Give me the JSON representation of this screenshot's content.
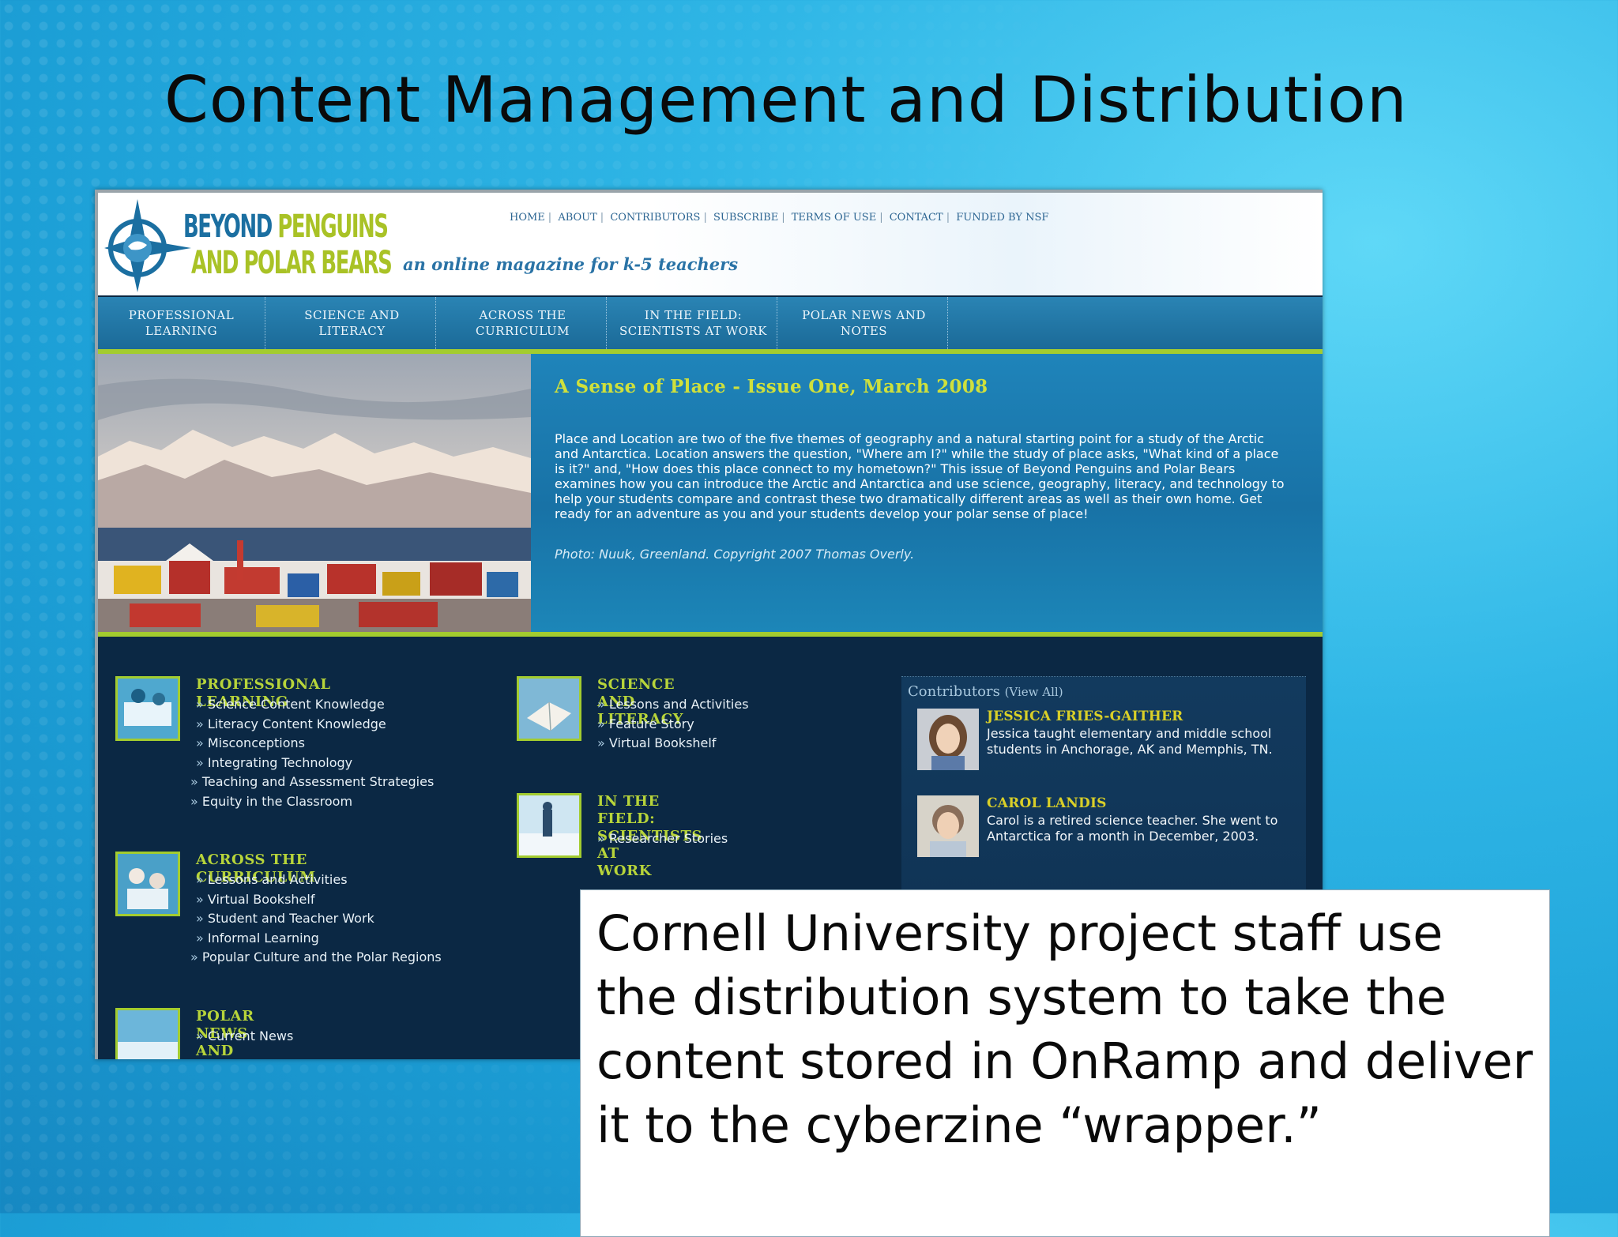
{
  "slide": {
    "title": "Content Management and Distribution",
    "callout": "Cornell University project staff use the distribution system to take the content stored in OnRamp and deliver it to the cyberzine “wrapper.”"
  },
  "site": {
    "logo": {
      "line1_a": "BEYOND",
      "line1_b": "PENGUINS",
      "line2": "AND POLAR BEARS"
    },
    "tagline": "an online magazine for k-5 teachers",
    "top_links": [
      "HOME",
      "ABOUT",
      "CONTRIBUTORS",
      "SUBSCRIBE",
      "TERMS OF USE",
      "CONTACT",
      "FUNDED BY NSF"
    ],
    "nav": [
      "PROFESSIONAL\nLEARNING",
      "SCIENCE AND\nLITERACY",
      "ACROSS THE\nCURRICULUM",
      "IN THE FIELD:\nSCIENTISTS AT WORK",
      "POLAR NEWS AND\nNOTES"
    ],
    "hero": {
      "title": "A Sense of Place - Issue One, March 2008",
      "body": "Place and Location are two of the five themes of geography and a natural starting point for a study of the Arctic and Antarctica. Location answers the question, \"Where am I?\" while the study of place asks, \"What kind of a place is it?\" and, \"How does this place connect to my hometown?\" This issue of Beyond Penguins and Polar Bears examines how you can introduce the Arctic and Antarctica and use science, geography, literacy, and technology to help your students compare and contrast these two dramatically different areas as well as their own home. Get ready for an adventure as you and your students develop your polar sense of place!",
      "credit": "Photo: Nuuk, Greenland. Copyright 2007 Thomas Overly."
    },
    "sections": {
      "prof": {
        "title": "PROFESSIONAL LEARNING",
        "items": [
          "Science Content Knowledge",
          "Literacy Content Knowledge",
          "Misconceptions",
          "Integrating Technology",
          "Teaching and Assessment Strategies",
          "Equity in the Classroom"
        ]
      },
      "sci": {
        "title": "SCIENCE AND LITERACY",
        "items": [
          "Lessons and Activities",
          "Feature Story",
          "Virtual Bookshelf"
        ]
      },
      "field": {
        "title": "IN THE FIELD: SCIENTISTS AT\nWORK",
        "items": [
          "Researcher Stories"
        ]
      },
      "across": {
        "title": "ACROSS THE CURRICULUM",
        "items": [
          "Lessons and Activities",
          "Virtual Bookshelf",
          "Student and Teacher Work",
          "Informal Learning",
          "Popular Culture and the Polar Regions"
        ]
      },
      "news": {
        "title": "POLAR NEWS AND NOTES",
        "items": [
          "Current News"
        ]
      }
    },
    "contributors": {
      "heading": "Contributors",
      "view_all": "(View All)",
      "people": [
        {
          "name": "JESSICA FRIES-GAITHER",
          "bio": "Jessica taught elementary and middle school students in Anchorage, AK and Memphis, TN."
        },
        {
          "name": "CAROL LANDIS",
          "bio": "Carol is a retired science teacher. She went to Antarctica for a month in December, 2003."
        }
      ]
    }
  }
}
